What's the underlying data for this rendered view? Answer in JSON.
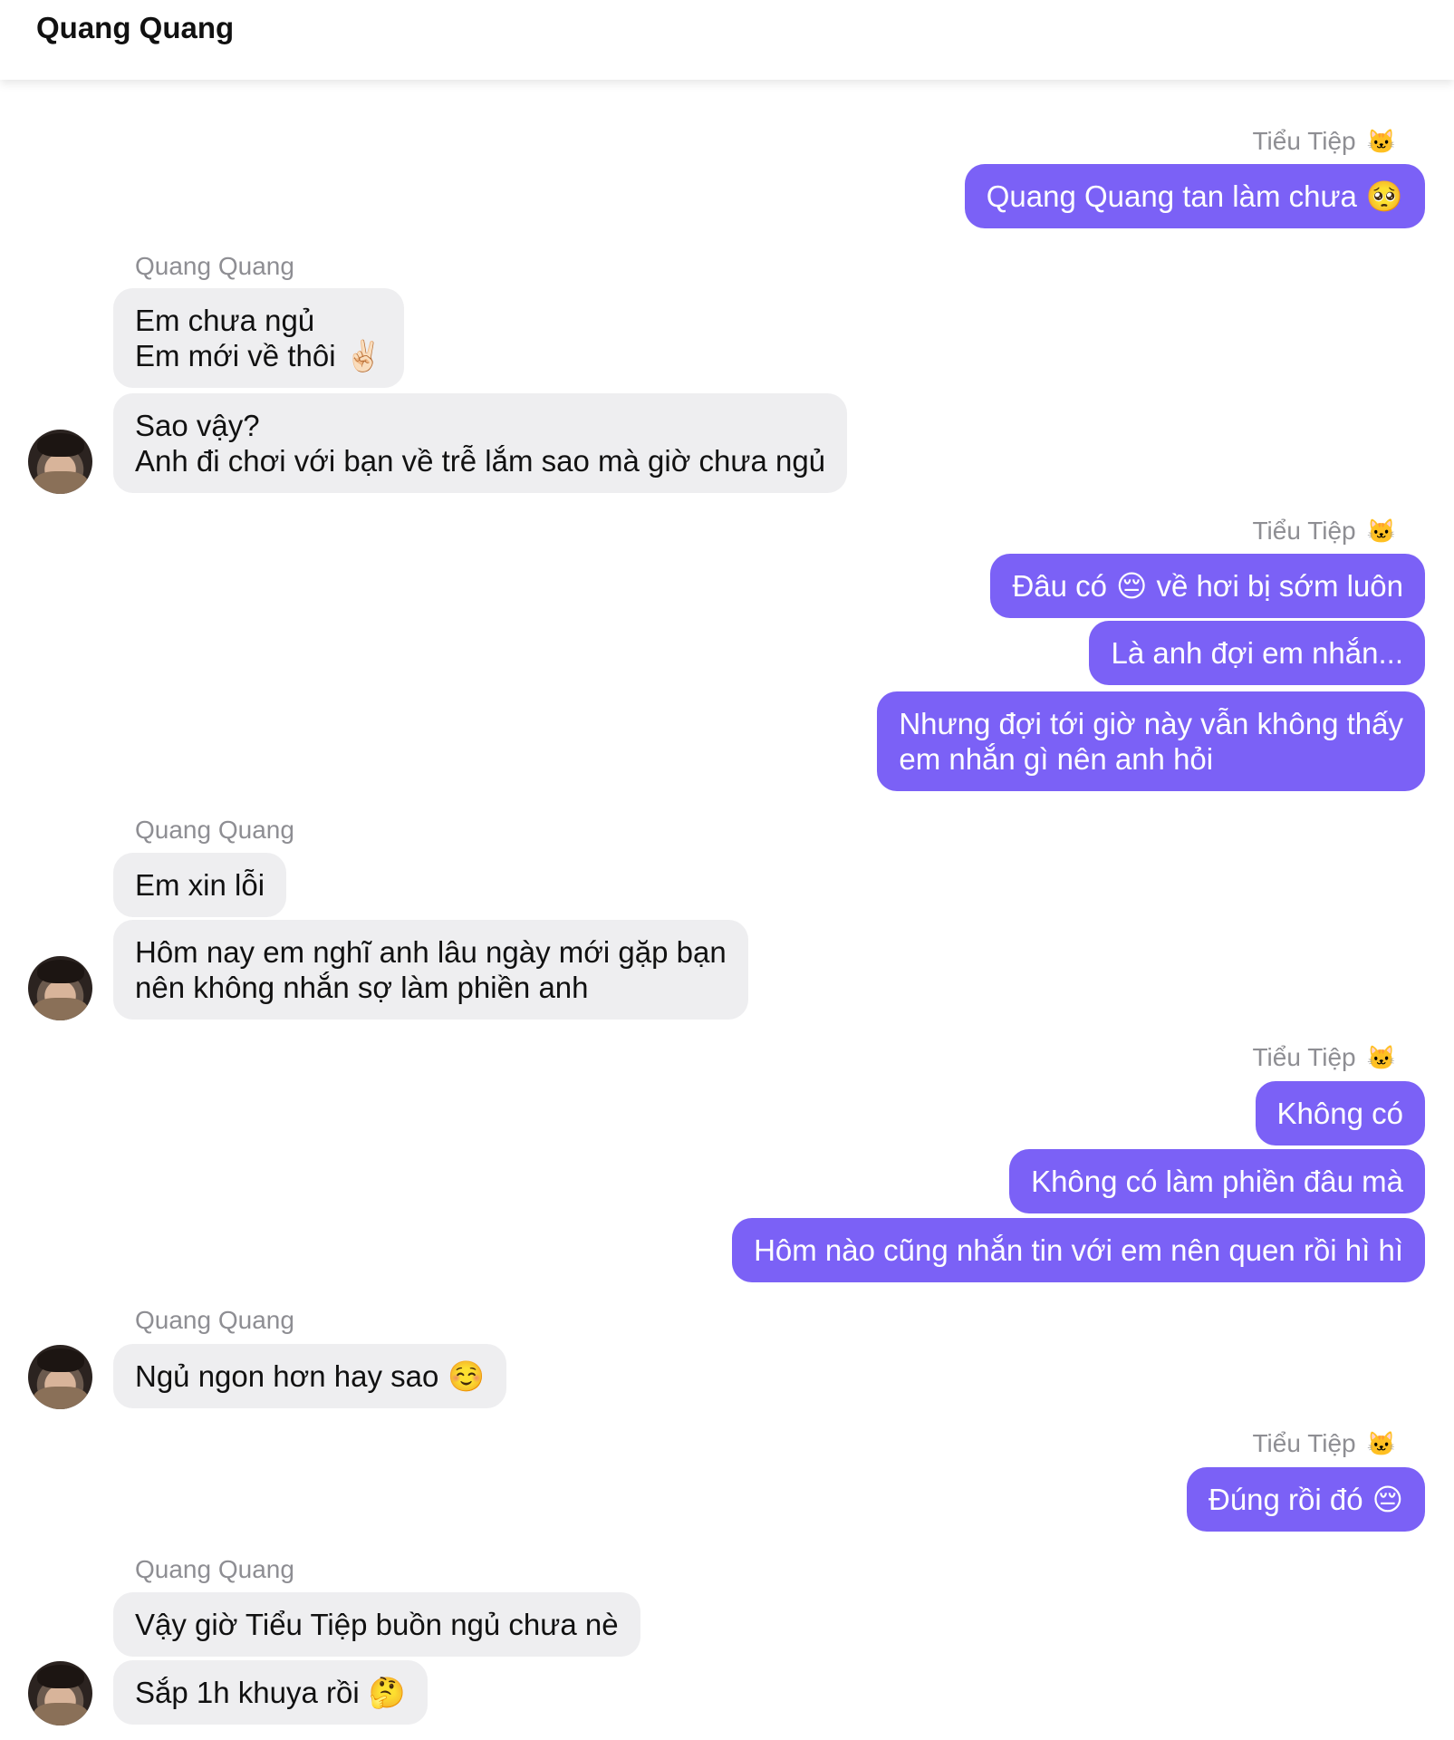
{
  "header": {
    "title": "Quang Quang"
  },
  "names": {
    "me": "Tiểu Tiệp",
    "other": "Quang Quang",
    "me_badge": "cat-face-emoji"
  },
  "messages": {
    "m1": {
      "text": "Quang Quang tan làm chưa",
      "emoji": "🥺"
    },
    "m2": {
      "line1": "Em chưa ngủ",
      "line2": "Em mới về thôi",
      "emoji": "✌🏻"
    },
    "m3": {
      "line1": "Sao vậy?",
      "line2": "Anh đi chơi với bạn về trễ lắm sao mà giờ chưa ngủ"
    },
    "m4": {
      "before": "Đâu có",
      "emoji": "😔",
      "after": "về hơi bị sớm luôn"
    },
    "m5": {
      "text": "Là anh đợi em nhắn..."
    },
    "m6": {
      "line1": "Nhưng đợi tới giờ này vẫn không thấy",
      "line2": "em nhắn gì nên anh hỏi"
    },
    "m7": {
      "text": "Em xin lỗi"
    },
    "m8": {
      "line1": "Hôm nay em nghĩ anh lâu ngày mới gặp bạn",
      "line2": "nên không nhắn sợ làm phiền anh"
    },
    "m9": {
      "text": "Không có"
    },
    "m10": {
      "text": "Không có làm phiền đâu mà"
    },
    "m11": {
      "text": "Hôm nào cũng nhắn tin với em nên quen rồi hì hì"
    },
    "m12": {
      "text": "Ngủ ngon hơn hay sao",
      "emoji": "☺️"
    },
    "m13": {
      "text": "Đúng rồi đó",
      "emoji": "😔"
    },
    "m14": {
      "text": "Vậy giờ Tiểu Tiệp buồn ngủ chưa nè"
    },
    "m15": {
      "text": "Sắp 1h khuya rồi",
      "emoji": "🤔"
    }
  },
  "colors": {
    "outgoing_bubble": "#7b61f6",
    "incoming_bubble": "#eeeef0",
    "sender_label": "#8e8e93"
  }
}
